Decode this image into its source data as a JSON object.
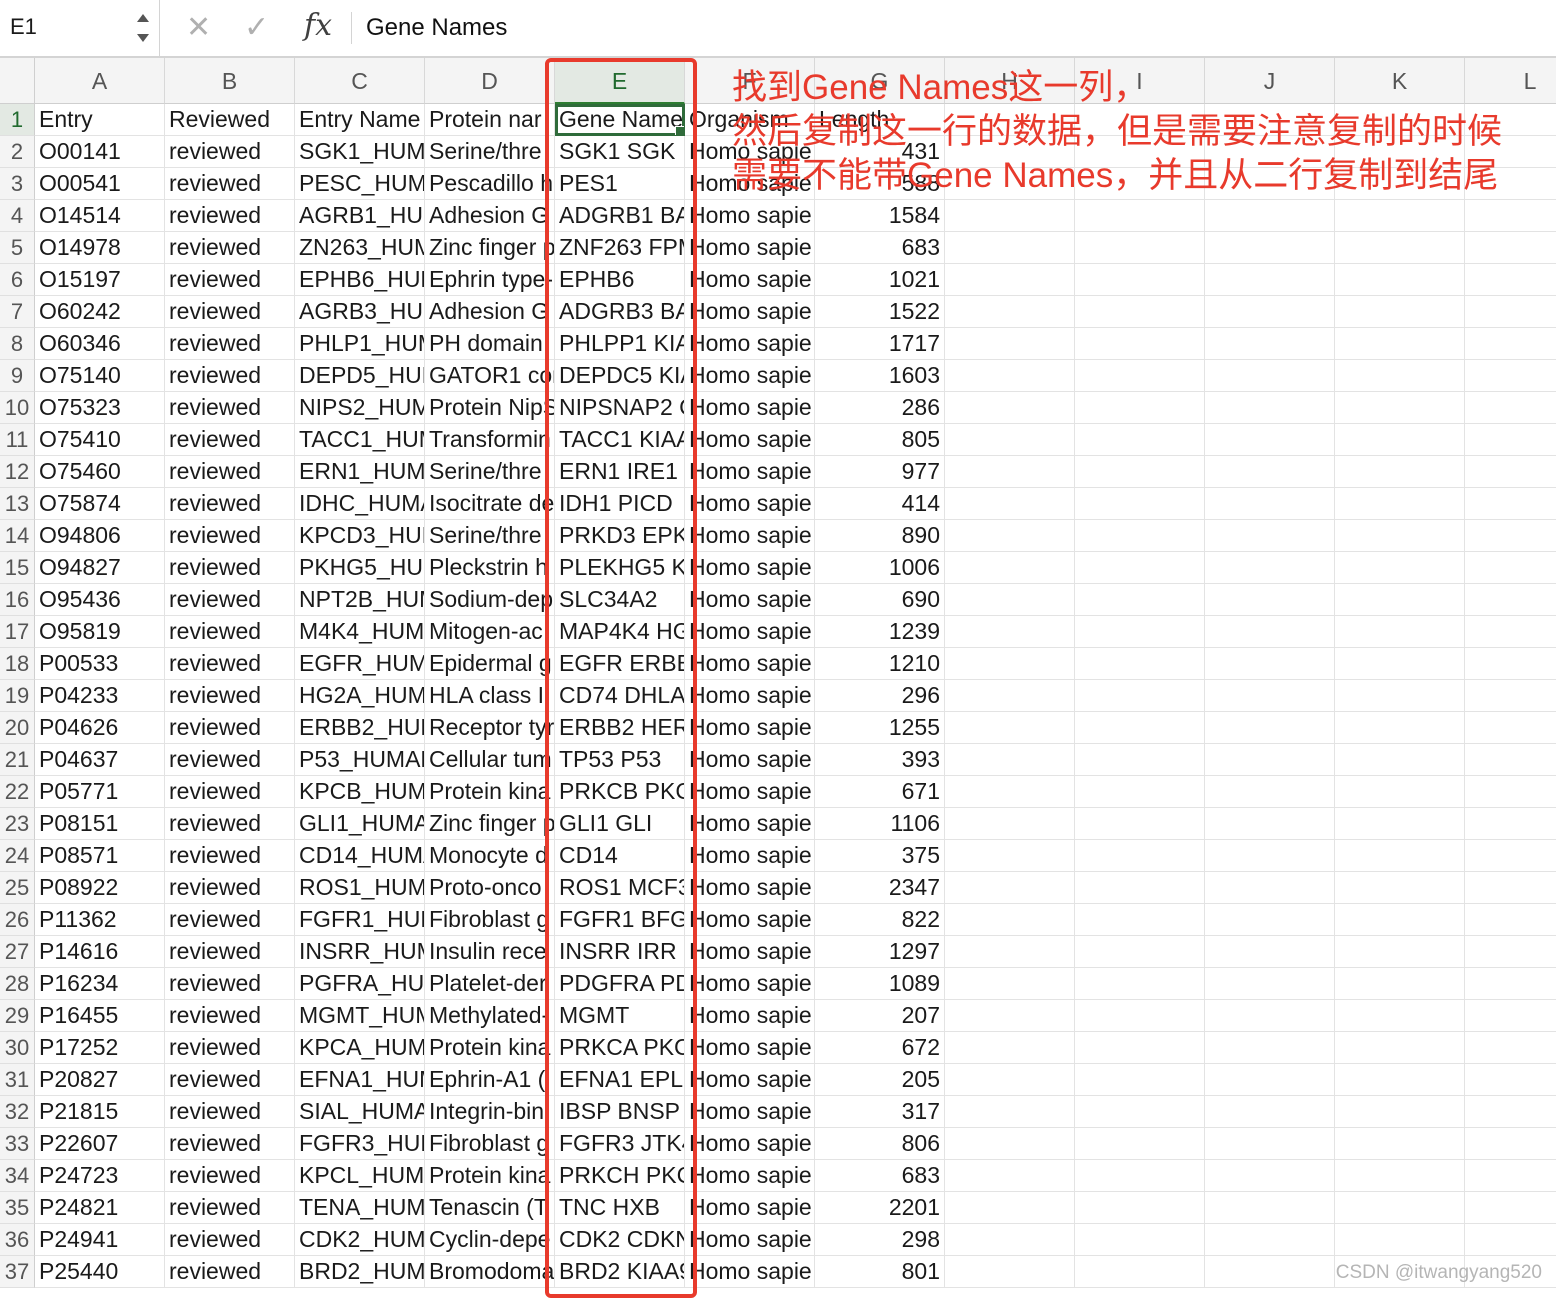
{
  "formula_bar": {
    "cell_reference": "E1",
    "cancel_icon": "✕",
    "confirm_icon": "✓",
    "fx_label": "fx",
    "content": "Gene Names"
  },
  "sheet": {
    "column_headers": [
      "A",
      "B",
      "C",
      "D",
      "E",
      "F",
      "G",
      "H",
      "I",
      "J",
      "K",
      "L"
    ],
    "active_cell": "E1",
    "rows": [
      {
        "n": "1",
        "a": "Entry",
        "b": "Reviewed",
        "c": "Entry Name",
        "d": "Protein nar",
        "e": "Gene Names",
        "f": "Organism",
        "g": "Length"
      },
      {
        "n": "2",
        "a": "O00141",
        "b": "reviewed",
        "c": "SGK1_HUMA",
        "d": "Serine/thre",
        "e": "SGK1 SGK",
        "f": "Homo sapie",
        "g": "431"
      },
      {
        "n": "3",
        "a": "O00541",
        "b": "reviewed",
        "c": "PESC_HUMA",
        "d": "Pescadillo h",
        "e": "PES1",
        "f": "Homo sapie",
        "g": "588"
      },
      {
        "n": "4",
        "a": "O14514",
        "b": "reviewed",
        "c": "AGRB1_HUM",
        "d": "Adhesion G",
        "e": "ADGRB1 BA",
        "f": "Homo sapie",
        "g": "1584"
      },
      {
        "n": "5",
        "a": "O14978",
        "b": "reviewed",
        "c": "ZN263_HUM",
        "d": "Zinc finger p",
        "e": "ZNF263 FPM",
        "f": "Homo sapie",
        "g": "683"
      },
      {
        "n": "6",
        "a": "O15197",
        "b": "reviewed",
        "c": "EPHB6_HUM",
        "d": "Ephrin type-",
        "e": "EPHB6",
        "f": "Homo sapie",
        "g": "1021"
      },
      {
        "n": "7",
        "a": "O60242",
        "b": "reviewed",
        "c": "AGRB3_HUM",
        "d": "Adhesion G",
        "e": "ADGRB3 BA",
        "f": "Homo sapie",
        "g": "1522"
      },
      {
        "n": "8",
        "a": "O60346",
        "b": "reviewed",
        "c": "PHLP1_HUM",
        "d": "PH domain",
        "e": "PHLPP1 KIA",
        "f": "Homo sapie",
        "g": "1717"
      },
      {
        "n": "9",
        "a": "O75140",
        "b": "reviewed",
        "c": "DEPD5_HUM",
        "d": "GATOR1 cor",
        "e": "DEPDC5 KIA",
        "f": "Homo sapie",
        "g": "1603"
      },
      {
        "n": "10",
        "a": "O75323",
        "b": "reviewed",
        "c": "NIPS2_HUM",
        "d": "Protein NipS",
        "e": "NIPSNAP2 G",
        "f": "Homo sapie",
        "g": "286"
      },
      {
        "n": "11",
        "a": "O75410",
        "b": "reviewed",
        "c": "TACC1_HUM",
        "d": "Transformin",
        "e": "TACC1 KIAA",
        "f": "Homo sapie",
        "g": "805"
      },
      {
        "n": "12",
        "a": "O75460",
        "b": "reviewed",
        "c": "ERN1_HUMA",
        "d": "Serine/thre",
        "e": "ERN1 IRE1",
        "f": "Homo sapie",
        "g": "977"
      },
      {
        "n": "13",
        "a": "O75874",
        "b": "reviewed",
        "c": "IDHC_HUMA",
        "d": "Isocitrate de",
        "e": "IDH1 PICD",
        "f": "Homo sapie",
        "g": "414"
      },
      {
        "n": "14",
        "a": "O94806",
        "b": "reviewed",
        "c": "KPCD3_HUM",
        "d": "Serine/thre",
        "e": "PRKD3 EPK2",
        "f": "Homo sapie",
        "g": "890"
      },
      {
        "n": "15",
        "a": "O94827",
        "b": "reviewed",
        "c": "PKHG5_HUM",
        "d": "Pleckstrin h",
        "e": "PLEKHG5 KI",
        "f": "Homo sapie",
        "g": "1006"
      },
      {
        "n": "16",
        "a": "O95436",
        "b": "reviewed",
        "c": "NPT2B_HUM",
        "d": "Sodium-dep",
        "e": "SLC34A2",
        "f": "Homo sapie",
        "g": "690"
      },
      {
        "n": "17",
        "a": "O95819",
        "b": "reviewed",
        "c": "M4K4_HUMA",
        "d": "Mitogen-ac",
        "e": "MAP4K4 HG",
        "f": "Homo sapie",
        "g": "1239"
      },
      {
        "n": "18",
        "a": "P00533",
        "b": "reviewed",
        "c": "EGFR_HUMA",
        "d": "Epidermal g",
        "e": "EGFR ERBB E",
        "f": "Homo sapie",
        "g": "1210"
      },
      {
        "n": "19",
        "a": "P04233",
        "b": "reviewed",
        "c": "HG2A_HUMA",
        "d": "HLA class II",
        "e": "CD74 DHLAG",
        "f": "Homo sapie",
        "g": "296"
      },
      {
        "n": "20",
        "a": "P04626",
        "b": "reviewed",
        "c": "ERBB2_HUM",
        "d": "Receptor tyr",
        "e": "ERBB2 HER2",
        "f": "Homo sapie",
        "g": "1255"
      },
      {
        "n": "21",
        "a": "P04637",
        "b": "reviewed",
        "c": "P53_HUMAN",
        "d": "Cellular tum",
        "e": "TP53 P53",
        "f": "Homo sapie",
        "g": "393"
      },
      {
        "n": "22",
        "a": "P05771",
        "b": "reviewed",
        "c": "KPCB_HUMA",
        "d": "Protein kina",
        "e": "PRKCB PKCB",
        "f": "Homo sapie",
        "g": "671"
      },
      {
        "n": "23",
        "a": "P08151",
        "b": "reviewed",
        "c": "GLI1_HUMA",
        "d": "Zinc finger p",
        "e": "GLI1 GLI",
        "f": "Homo sapie",
        "g": "1106"
      },
      {
        "n": "24",
        "a": "P08571",
        "b": "reviewed",
        "c": "CD14_HUMA",
        "d": "Monocyte d",
        "e": "CD14",
        "f": "Homo sapie",
        "g": "375"
      },
      {
        "n": "25",
        "a": "P08922",
        "b": "reviewed",
        "c": "ROS1_HUMA",
        "d": "Proto-onco",
        "e": "ROS1 MCF3",
        "f": "Homo sapie",
        "g": "2347"
      },
      {
        "n": "26",
        "a": "P11362",
        "b": "reviewed",
        "c": "FGFR1_HUM",
        "d": "Fibroblast g",
        "e": "FGFR1 BFGF",
        "f": "Homo sapie",
        "g": "822"
      },
      {
        "n": "27",
        "a": "P14616",
        "b": "reviewed",
        "c": "INSRR_HUM",
        "d": "Insulin rece",
        "e": "INSRR IRR",
        "f": "Homo sapie",
        "g": "1297"
      },
      {
        "n": "28",
        "a": "P16234",
        "b": "reviewed",
        "c": "PGFRA_HUM",
        "d": "Platelet-der",
        "e": "PDGFRA PD",
        "f": "Homo sapie",
        "g": "1089"
      },
      {
        "n": "29",
        "a": "P16455",
        "b": "reviewed",
        "c": "MGMT_HUM",
        "d": "Methylated-",
        "e": "MGMT",
        "f": "Homo sapie",
        "g": "207"
      },
      {
        "n": "30",
        "a": "P17252",
        "b": "reviewed",
        "c": "KPCA_HUMA",
        "d": "Protein kina",
        "e": "PRKCA PKCA",
        "f": "Homo sapie",
        "g": "672"
      },
      {
        "n": "31",
        "a": "P20827",
        "b": "reviewed",
        "c": "EFNA1_HUM",
        "d": "Ephrin-A1 (",
        "e": "EFNA1 EPLG",
        "f": "Homo sapie",
        "g": "205"
      },
      {
        "n": "32",
        "a": "P21815",
        "b": "reviewed",
        "c": "SIAL_HUMA",
        "d": "Integrin-bin",
        "e": "IBSP BNSP",
        "f": "Homo sapie",
        "g": "317"
      },
      {
        "n": "33",
        "a": "P22607",
        "b": "reviewed",
        "c": "FGFR3_HUM",
        "d": "Fibroblast g",
        "e": "FGFR3 JTK4",
        "f": "Homo sapie",
        "g": "806"
      },
      {
        "n": "34",
        "a": "P24723",
        "b": "reviewed",
        "c": "KPCL_HUMA",
        "d": "Protein kina",
        "e": "PRKCH PKCL",
        "f": "Homo sapie",
        "g": "683"
      },
      {
        "n": "35",
        "a": "P24821",
        "b": "reviewed",
        "c": "TENA_HUMA",
        "d": "Tenascin (T",
        "e": "TNC HXB",
        "f": "Homo sapie",
        "g": "2201"
      },
      {
        "n": "36",
        "a": "P24941",
        "b": "reviewed",
        "c": "CDK2_HUMA",
        "d": "Cyclin-depe",
        "e": "CDK2 CDKN",
        "f": "Homo sapie",
        "g": "298"
      },
      {
        "n": "37",
        "a": "P25440",
        "b": "reviewed",
        "c": "BRD2_HUMA",
        "d": "Bromodoma",
        "e": "BRD2 KIAA9",
        "f": "Homo sapie",
        "g": "801"
      }
    ]
  },
  "annotation": {
    "lines": [
      "找到Gene Names这一列，",
      "然后复制这一行的数据，但是需要注意复制的时候",
      "需要不能带Gene Names，并且从二行复制到结尾"
    ],
    "color": "#e83a2c"
  },
  "watermark": "CSDN @itwangyang520",
  "colors": {
    "selection_green": "#2f6b3a",
    "annotation_red": "#e83a2c"
  }
}
